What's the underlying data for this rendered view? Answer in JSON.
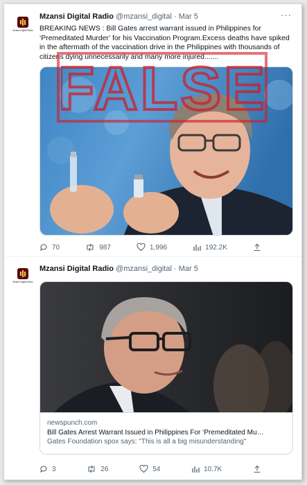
{
  "tweets": [
    {
      "avatar_text": "Mzansi Digital Radio",
      "name": "Mzansi Digital Radio",
      "handle": "@mzansi_digital",
      "separator": "·",
      "date": "Mar 5",
      "text": "BREAKING NEWS : Bill Gates arrest warrant issued in Philippines for ‘Premeditated Murder’ for his Vaccination Program.Excess deaths have spiked in the aftermath of the vaccination drive in the Philippines with thousands of citizens dying unnecessarily and many more injured.......",
      "stamp_text": "FALSE",
      "replies": "70",
      "retweets": "987",
      "likes": "1,996",
      "views": "192.2K"
    },
    {
      "avatar_text": "Mzansi Digital Radio",
      "name": "Mzansi Digital Radio",
      "handle": "@mzansi_digital",
      "separator": "·",
      "date": "Mar 5",
      "card": {
        "domain": "newspunch.com",
        "title": "Bill Gates Arrest Warrant Issued in Philippines For ‘Premeditated Mu…",
        "description": "Gates Foundation spox says: \"This is all a big misunderstanding\""
      },
      "replies": "3",
      "retweets": "26",
      "likes": "54",
      "views": "10.7K"
    }
  ],
  "colors": {
    "stamp_red": "#ce1e28",
    "muted_text": "#536471",
    "border": "#cfd9de"
  }
}
